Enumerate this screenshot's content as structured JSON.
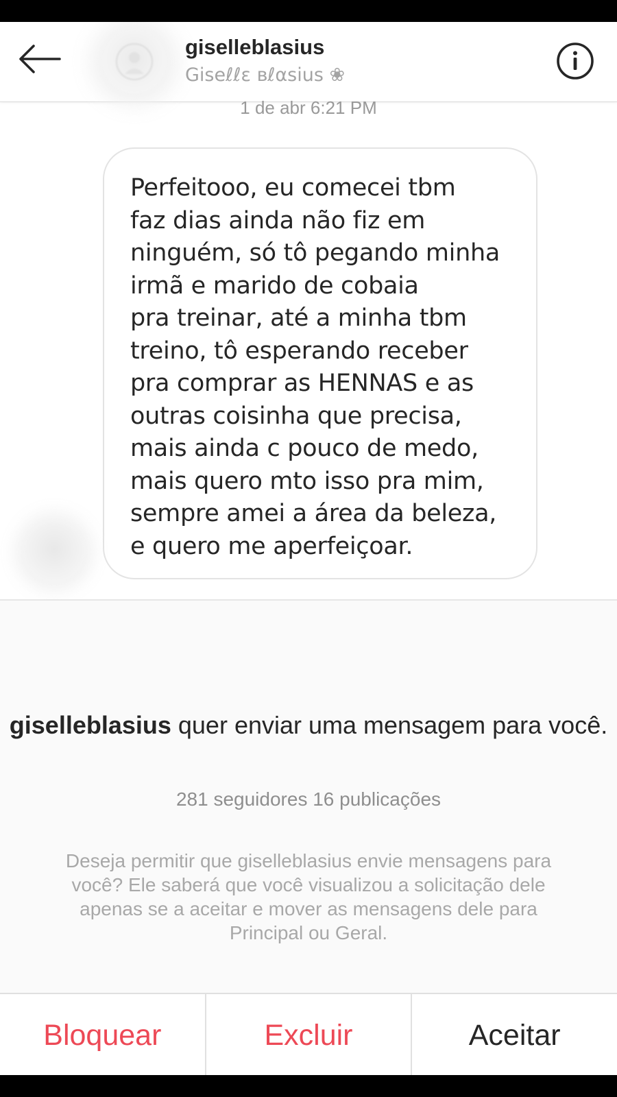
{
  "header": {
    "username": "giselleblasius",
    "full_name": "Giseℓℓɛ ʙℓαsius ❀",
    "back_icon": "arrow-left-icon",
    "info_icon": "info-circle-icon"
  },
  "conversation": {
    "timestamp": "1 de abr 6:21 PM",
    "message": "Perfeitooo, eu comecei tbm\nfaz dias ainda não fiz em\nninguém, só tô pegando minha\nirmã e marido de cobaia\npra treinar, até a minha tbm\ntreino, tô esperando receber\npra comprar as HENNAS e as\noutras coisinha que precisa,\nmais ainda c pouco de medo,\nmais quero mto isso pra mim,\nsempre amei a área da beleza,\ne quero me aperfeiçoar."
  },
  "request": {
    "username": "giselleblasius",
    "title_rest": " quer enviar uma mensagem para você.",
    "stats": "281 seguidores 16 publicações",
    "explanation": "Deseja permitir que giselleblasius envie mensagens para você? Ele saberá que você visualizou a solicitação dele apenas se a aceitar e mover as mensagens dele para Principal ou Geral."
  },
  "actions": {
    "block": "Bloquear",
    "delete": "Excluir",
    "accept": "Aceitar"
  },
  "colors": {
    "danger": "#ed4956",
    "text": "#262626",
    "muted": "#8e8e8e"
  }
}
